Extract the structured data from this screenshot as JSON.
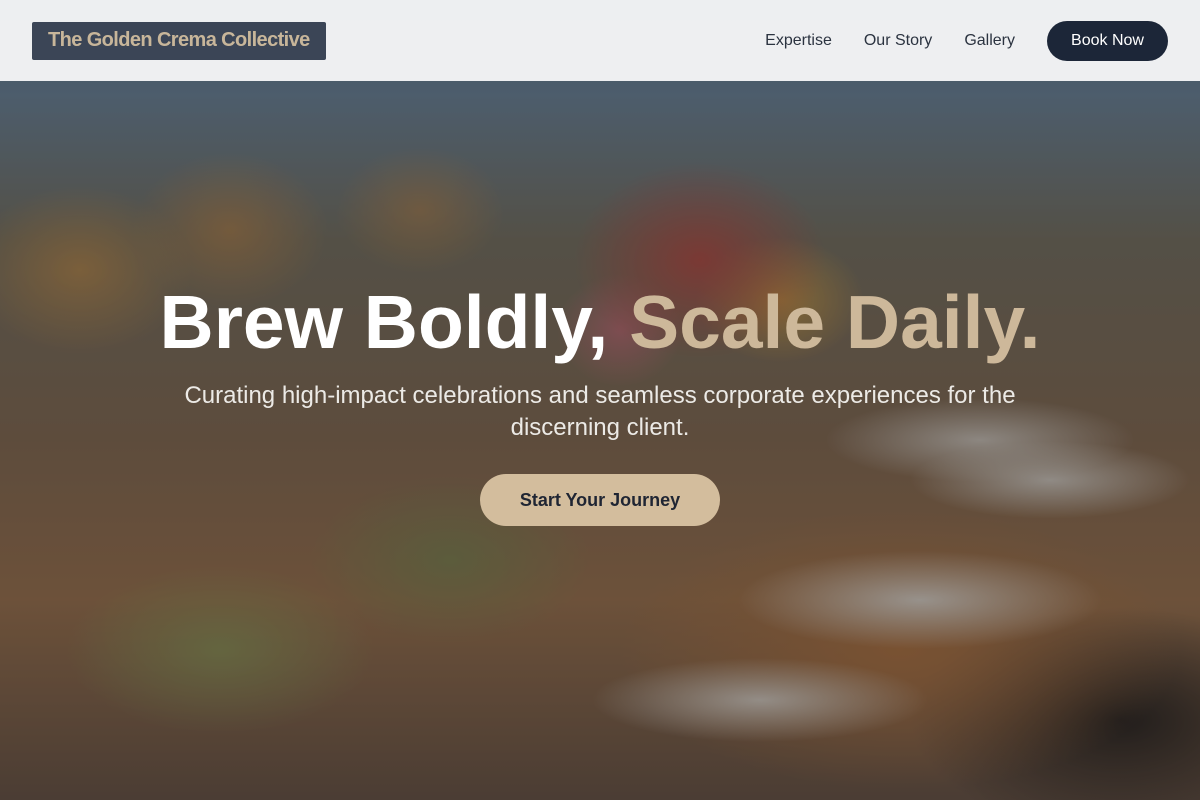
{
  "brand": {
    "name": "The Golden Crema Collective"
  },
  "nav": {
    "links": [
      "Expertise",
      "Our Story",
      "Gallery"
    ],
    "book_label": "Book Now"
  },
  "hero": {
    "headline_part1": "Brew Boldly,",
    "headline_part2": "Scale Daily.",
    "subtext": "Curating high-impact celebrations and seamless corporate experiences for the discerning client.",
    "cta_label": "Start Your Journey"
  },
  "colors": {
    "header_bg": "#f5f6f7",
    "logo_bg": "#3b4556",
    "logo_text": "#c8b69a",
    "book_button_bg": "#1c2638",
    "accent": "#cdb89a",
    "cta_bg": "#d3bd9d"
  }
}
